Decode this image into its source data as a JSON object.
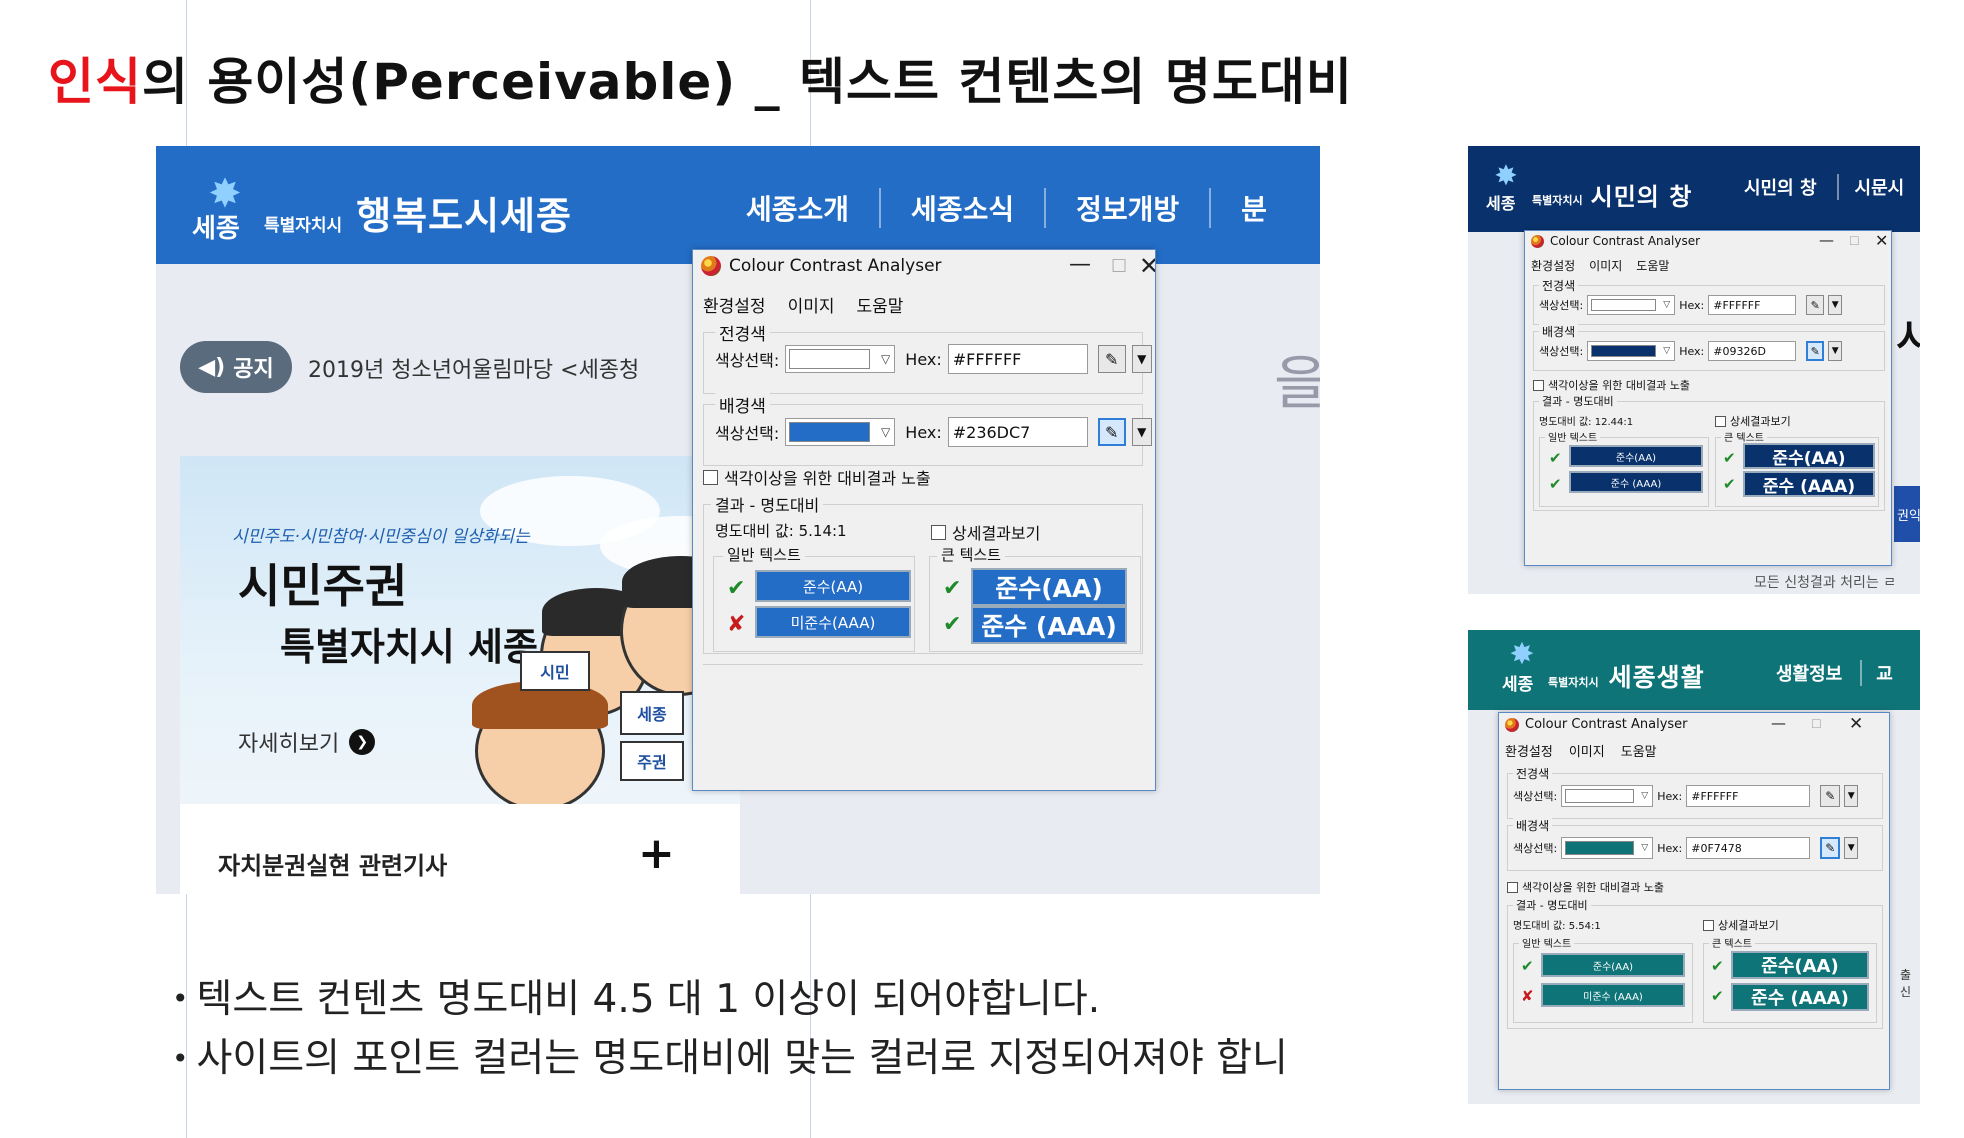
{
  "slide": {
    "title_accent": "인식",
    "title_rest": "의 용이성(Perceivable) _ 텍스트 컨텐츠의 명도대비"
  },
  "bullets": [
    "텍스트 컨텐츠 명도대비 4.5 대 1 이상이 되어야합니다.",
    "사이트의 포인트 컬러는 명도대비에 맞는 컬러로 지정되어져야 합니"
  ],
  "colors": {
    "accent_red": "#e8141c",
    "sejong_blue": "#236DC7",
    "citizen_navy": "#09326D",
    "life_green": "#0F7478",
    "pass_green": "#1f8a2a",
    "fail_red": "#c81c1c"
  },
  "main_site": {
    "logo_word": "세종",
    "logo_sub": "특별자치시",
    "site_name": "행복도시세종",
    "nav": [
      "세종소개",
      "세종소식",
      "정보개방",
      "분"
    ],
    "notice_label": "공지",
    "notice_icon": "speaker-icon",
    "notice_text": "2019년 청소년어울림마당 <세종청",
    "banner_tagline": "시민주도·시민참여·시민중심이 일상화되는",
    "banner_line1": "시민주권",
    "banner_line2": "특별자치시 세종",
    "banner_more": "자세히보기",
    "banner_signs": [
      "시민",
      "세종",
      "주권"
    ],
    "article_title": "자치분권실현 관련기사",
    "article_plus": "+",
    "edge_glyph": "을"
  },
  "dialog": {
    "title": "Colour Contrast Analyser",
    "menu": [
      "환경설정",
      "이미지",
      "도움말"
    ],
    "fg_group": "전경색",
    "bg_group": "배경색",
    "pick_label": "색상선택:",
    "hex_label": "Hex:",
    "fg_hex": "#FFFFFF",
    "bg_hex": "#236DC7",
    "colorblind_label": "색각이상을 위한 대비결과 노출",
    "result_group": "결과 - 명도대비",
    "ratio": "명도대비 값: 5.14:1",
    "detail_label": "상세결과보기",
    "normal_text": "일반 텍스트",
    "large_text": "큰 텍스트",
    "normal_results": [
      {
        "mark": "✔",
        "label": "준수(AA)",
        "pass": true
      },
      {
        "mark": "✘",
        "label": "미준수(AAA)",
        "pass": false
      }
    ],
    "large_results": [
      {
        "mark": "✔",
        "label": "준수(AA)",
        "pass": true
      },
      {
        "mark": "✔",
        "label": "준수 (AAA)",
        "pass": true
      }
    ]
  },
  "citizen_site": {
    "logo_word": "세종",
    "logo_sub": "특별자치시",
    "site_name": "시민의 창",
    "nav": [
      "시민의 창",
      "시문시"
    ],
    "edge_glyph": "시",
    "edge_tab": "권익",
    "footer": "모든 신청결과 처리는 ㄹ"
  },
  "citizen_dialog": {
    "title": "Colour Contrast Analyser",
    "menu": [
      "환경설정",
      "이미지",
      "도움말"
    ],
    "fg_group": "전경색",
    "bg_group": "배경색",
    "pick_label": "색상선택:",
    "hex_label": "Hex:",
    "fg_hex": "#FFFFFF",
    "bg_hex": "#09326D",
    "colorblind_label": "색각이상을 위한 대비결과 노출",
    "result_group": "결과 - 명도대비",
    "ratio": "명도대비 값: 12.44:1",
    "detail_label": "상세결과보기",
    "normal_text": "일반 텍스트",
    "large_text": "큰 텍스트",
    "normal_results": [
      {
        "mark": "✔",
        "label": "준수(AA)",
        "pass": true
      },
      {
        "mark": "✔",
        "label": "준수 (AAA)",
        "pass": true
      }
    ],
    "large_results": [
      {
        "mark": "✔",
        "label": "준수(AA)",
        "pass": true
      },
      {
        "mark": "✔",
        "label": "준수 (AAA)",
        "pass": true
      }
    ]
  },
  "life_site": {
    "logo_word": "세종",
    "logo_sub": "특별자치시",
    "site_name": "세종생활",
    "nav": [
      "생활정보",
      "교"
    ],
    "edge_text": "출신"
  },
  "life_dialog": {
    "title": "Colour Contrast Analyser",
    "menu": [
      "환경설정",
      "이미지",
      "도움말"
    ],
    "fg_group": "전경색",
    "bg_group": "배경색",
    "pick_label": "색상선택:",
    "hex_label": "Hex:",
    "fg_hex": "#FFFFFF",
    "bg_hex": "#0F7478",
    "colorblind_label": "색각이상을 위한 대비결과 노출",
    "result_group": "결과 - 명도대비",
    "ratio": "명도대비 값: 5.54:1",
    "detail_label": "상세결과보기",
    "normal_text": "일반 텍스트",
    "large_text": "큰 텍스트",
    "normal_results": [
      {
        "mark": "✔",
        "label": "준수(AA)",
        "pass": true
      },
      {
        "mark": "✘",
        "label": "미준수 (AAA)",
        "pass": false
      }
    ],
    "large_results": [
      {
        "mark": "✔",
        "label": "준수(AA)",
        "pass": true
      },
      {
        "mark": "✔",
        "label": "준수 (AAA)",
        "pass": true
      }
    ]
  }
}
